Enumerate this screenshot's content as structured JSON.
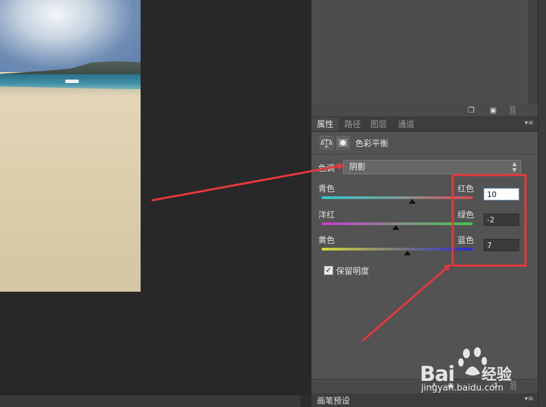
{
  "panel_tabs": [
    "属性",
    "路径",
    "图层",
    "通道"
  ],
  "properties": {
    "title": "色彩平衡",
    "tone_label": "色调",
    "tone_value": "阴影",
    "sliders": [
      {
        "left": "青色",
        "right": "红色",
        "value": "10",
        "fraction": 0.6
      },
      {
        "left": "洋红",
        "right": "绿色",
        "value": "-2",
        "fraction": 0.49
      },
      {
        "left": "黄色",
        "right": "蓝色",
        "value": "7",
        "fraction": 0.57
      }
    ],
    "preserve_luminosity": "保留明度",
    "preserve_checked": true
  },
  "brush_panel_tab": "画笔预设",
  "icons": {
    "history_footer": [
      "new-snapshot-icon",
      "camera-icon",
      "trash-icon"
    ],
    "properties_header": [
      "balance-scale-icon",
      "mask-icon"
    ],
    "props_footer": [
      "clip-icon",
      "visibility-icon",
      "reset-icon",
      "trash-icon"
    ]
  },
  "watermark": {
    "brand": "Bai",
    "brand_cn": "经验",
    "url": "jingyan.baidu.com"
  },
  "colors": {
    "annotation_red": "#e8383b",
    "panel_bg": "#535353",
    "input_active": "#ffffff"
  }
}
